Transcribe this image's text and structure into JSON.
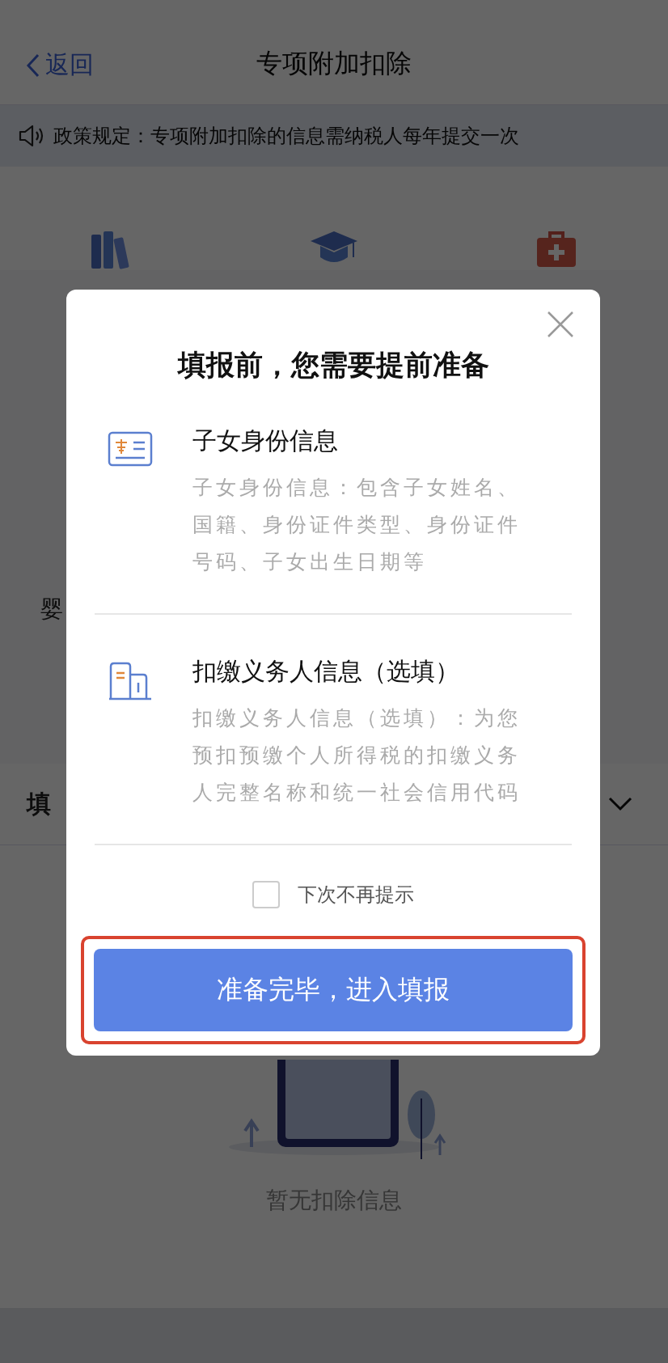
{
  "nav": {
    "back": "返回",
    "title": "专项附加扣除"
  },
  "notice": "政策规定：专项附加扣除的信息需纳税人每年提交一次",
  "categories": [
    {
      "kind": "books"
    },
    {
      "kind": "cap"
    },
    {
      "kind": "medkit"
    }
  ],
  "row_labels": [
    "婴"
  ],
  "section": {
    "title": "填"
  },
  "empty": {
    "text": "暂无扣除信息"
  },
  "dialog": {
    "title": "填报前，您需要提前准备",
    "items": [
      {
        "kind": "id-card",
        "title": "子女身份信息",
        "description": "子女身份信息：包含子女姓名、国籍、身份证件类型、身份证件号码、子女出生日期等"
      },
      {
        "kind": "building",
        "title": "扣缴义务人信息（选填）",
        "description": "扣缴义务人信息（选填）：为您预扣预缴个人所得税的扣缴义务人完整名称和统一社会信用代码"
      }
    ],
    "dont_remind": {
      "label": "下次不再提示",
      "checked": false
    },
    "confirm": "准备完毕，进入填报"
  }
}
